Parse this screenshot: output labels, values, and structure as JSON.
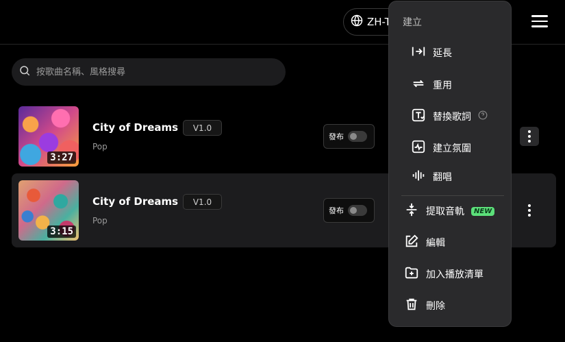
{
  "header": {
    "language_label": "ZH-T"
  },
  "search": {
    "placeholder": "按歌曲名稱、風格搜尋"
  },
  "songs": [
    {
      "title": "City of Dreams",
      "version": "V1.0",
      "genre": "Pop",
      "duration": "3:27",
      "publish_label": "發布",
      "published": false
    },
    {
      "title": "City of Dreams",
      "version": "V1.0",
      "genre": "Pop",
      "duration": "3:15",
      "publish_label": "發布",
      "published": false
    }
  ],
  "context_menu": {
    "header": "建立",
    "items": [
      {
        "label": "延長",
        "icon": "extend-icon"
      },
      {
        "label": "重用",
        "icon": "reuse-icon"
      },
      {
        "label": "替換歌詞",
        "icon": "replace-lyrics-icon"
      },
      {
        "label": "建立氛圍",
        "icon": "create-vibe-icon"
      },
      {
        "label": "翻唱",
        "icon": "cover-icon"
      },
      {
        "label": "提取音軌",
        "icon": "extract-tracks-icon",
        "badge": "NEW"
      },
      {
        "label": "編輯",
        "icon": "edit-icon"
      },
      {
        "label": "加入播放清單",
        "icon": "add-playlist-icon"
      },
      {
        "label": "刪除",
        "icon": "delete-icon"
      }
    ]
  },
  "colors": {
    "background": "#000000",
    "menu_background": "#2a2a2c",
    "new_badge": "#5ce07a"
  }
}
